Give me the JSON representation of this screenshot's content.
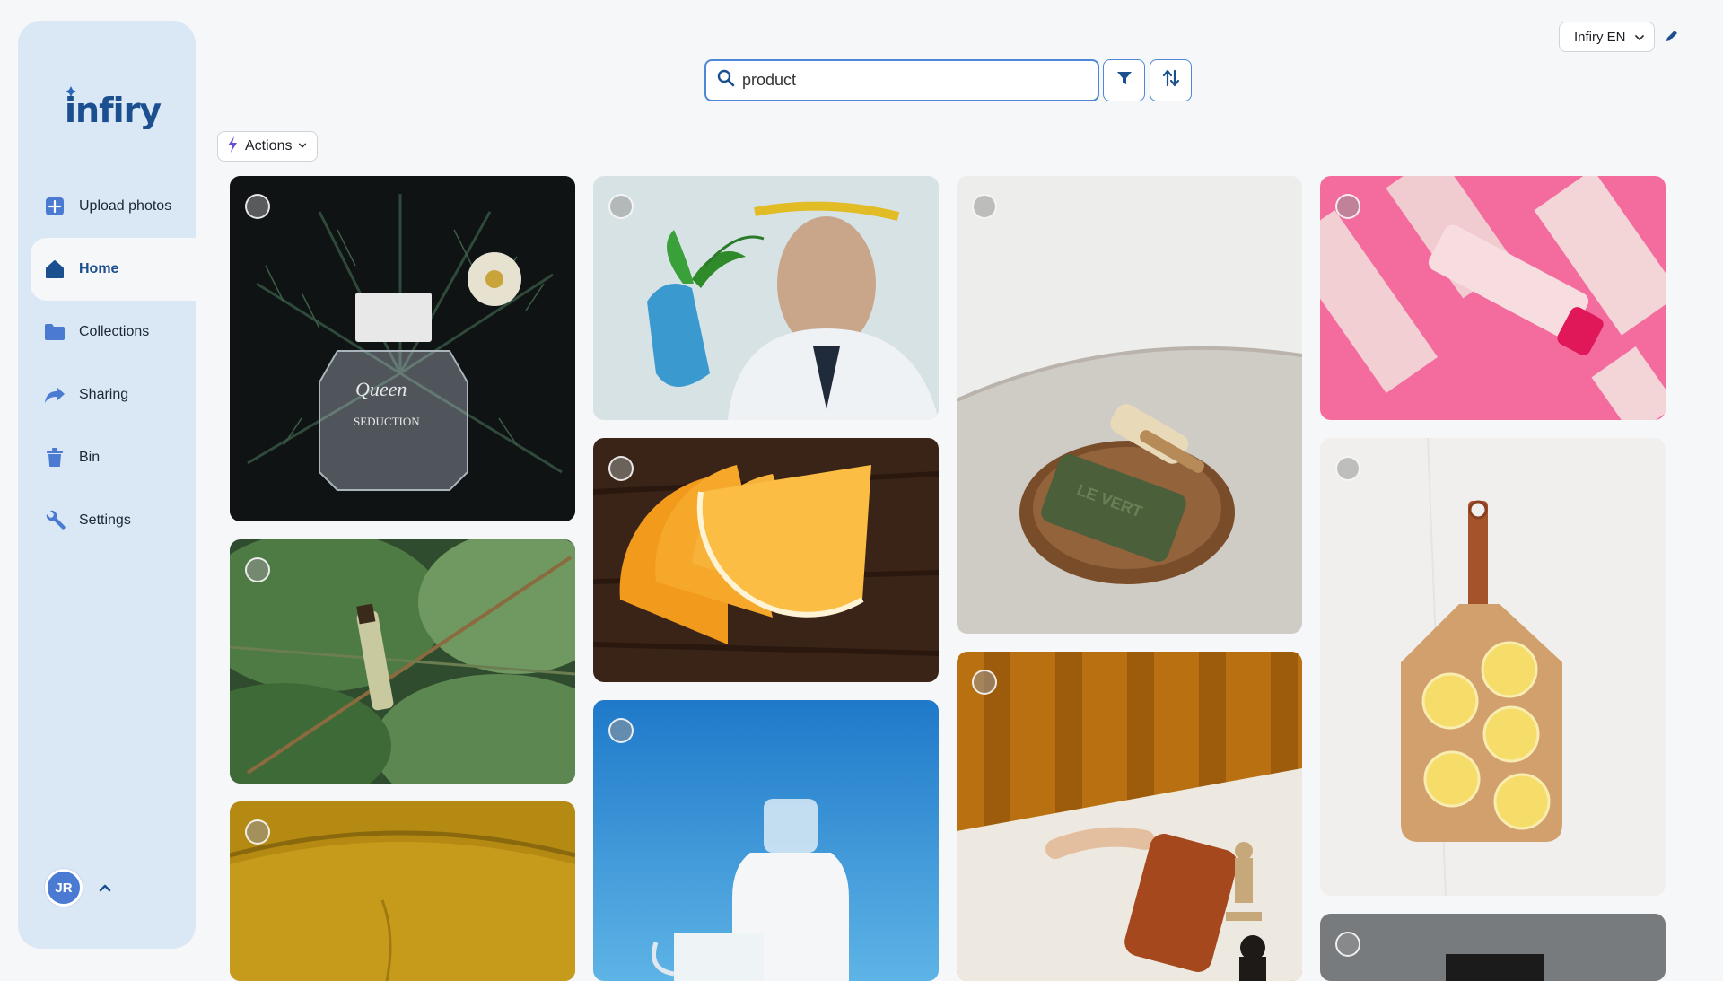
{
  "app": {
    "logo_text": "infiry",
    "brand_color": "#1b4f8f",
    "sidebar_bg": "#dae8f6"
  },
  "sidebar": {
    "items": [
      {
        "label": "Upload photos",
        "icon": "plus-square-icon"
      },
      {
        "label": "Home",
        "icon": "home-icon",
        "active": true
      },
      {
        "label": "Collections",
        "icon": "folder-icon"
      },
      {
        "label": "Sharing",
        "icon": "share-arrow-icon"
      },
      {
        "label": "Bin",
        "icon": "trash-icon"
      },
      {
        "label": "Settings",
        "icon": "wrench-icon"
      }
    ],
    "user": {
      "initials": "JR"
    }
  },
  "search": {
    "value": "product",
    "placeholder": "Search"
  },
  "header": {
    "language": "Infiry EN"
  },
  "toolbar": {
    "actions_label": "Actions"
  },
  "photos": [
    {
      "subject": "perfume bottle on pine branches"
    },
    {
      "subject": "scientist holding leaf"
    },
    {
      "subject": "soap bar with brush on towel"
    },
    {
      "subject": "pink cosmetic tubes and boxes"
    },
    {
      "subject": "oil vial on green leaves"
    },
    {
      "subject": "orange slices on wood"
    },
    {
      "subject": "lemon halves on cutting board"
    },
    {
      "subject": "yellow fabric cushion"
    },
    {
      "subject": "milk bottles on blue background"
    },
    {
      "subject": "hand with leather wallet and chess pieces"
    },
    {
      "subject": "dark product on gray background"
    }
  ]
}
